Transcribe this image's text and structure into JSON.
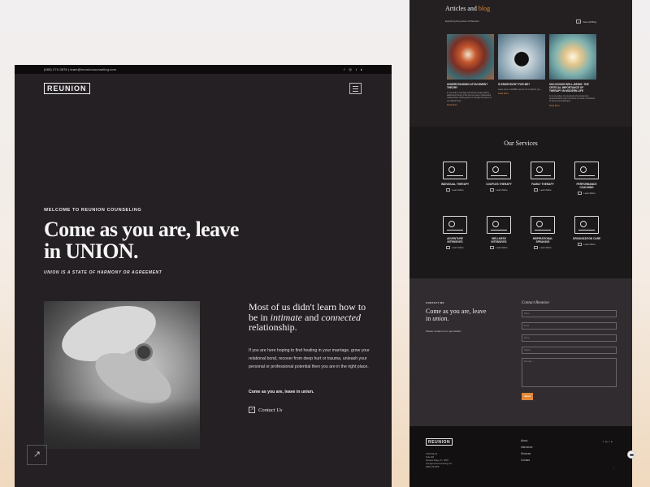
{
  "left": {
    "topbar": {
      "contact": "(585) 270-3878 | team@reunioncounseling.com",
      "socials": [
        "f",
        "◎",
        "t",
        "▸"
      ]
    },
    "logo": "REUNION",
    "welcome": "WELCOME TO REUNION COUNSELING",
    "hero": {
      "title": "Come as you are, leave in UNION.",
      "subtitle": "UNION IS A STATE OF HARMONY OR AGREEMENT"
    },
    "intro": {
      "heading_1": "Most of us didn't learn how to be in ",
      "heading_em1": "intimate",
      "heading_2": " and ",
      "heading_em2": "connected",
      "heading_3": " relationship.",
      "body": "If you are here hoping to find healing in your marriage, grow your relational bond, recover from deep hurt or trauma, unleash your personal or professional potential then you are in the right place.",
      "tagline": "Come as you are, leave in union.",
      "contact_label": "Contact Us"
    },
    "scroll_icon": "↗"
  },
  "right": {
    "blog": {
      "title_1": "Articles and ",
      "title_accent": "blog",
      "subtitle": "Exploring the power of Reunion",
      "view_all": "View all Blog",
      "cards": [
        {
          "title": "UNDERSTANDING ATTACHMENT THEORY",
          "excerpt": "In our work in marriage and family therapy (MFT), attachment theory is the lens we use to understand relationships, helping guide us through the layers of our attachments.",
          "more": "Read More"
        },
        {
          "title": "IS EMDR RIGHT FOR ME?",
          "excerpt": "Learn more on EMDR and see if it is right for you...",
          "more": "Read More"
        },
        {
          "title": "UNLOCKING WELL-BEING: THE CRITICAL IMPORTANCE OF THERAPY IN MODERN LIFE",
          "excerpt": "In an era where the demands of personal and professional life often intertwine to create a whirlwind of stress and challenges...",
          "more": "Read More"
        }
      ]
    },
    "services": {
      "title": "Our Services",
      "items": [
        {
          "name": "INDIVIDUAL THERAPY",
          "more": "Learn More"
        },
        {
          "name": "COUPLES THERAPY",
          "more": "Learn More"
        },
        {
          "name": "FAMILY THERAPY",
          "more": "Learn More"
        },
        {
          "name": "PERFORMANCE COACHING",
          "more": "Learn More"
        },
        {
          "name": "ADVENTURE INTENSIVES",
          "more": "Learn More"
        },
        {
          "name": "WELLNESS INTENSIVES",
          "more": "Learn More"
        },
        {
          "name": "INSPIRATIONAL SPEAKING",
          "more": "Learn More"
        },
        {
          "name": "ORGANIZATION CARE",
          "more": "Learn More"
        }
      ]
    },
    "contact": {
      "kicker": "CONTACT ME",
      "heading_1": "Come as you are, leave in ",
      "heading_em": "union.",
      "note": "Please contact me to get started",
      "form_title": "Contact Reunion",
      "fields": [
        "Name",
        "Email",
        "Phone",
        "Subject",
        "Message"
      ],
      "submit": "Send"
    },
    "footer": {
      "logo": "REUNION",
      "address": [
        "1790 Holly St",
        "Suite 300",
        "Pleasant Ridge, NY 14567",
        "team@reunioncounseling.com",
        "(585) 270-3878"
      ],
      "nav": [
        "About",
        "Intensives",
        "Services",
        "Contact"
      ],
      "socials": [
        "f",
        "◎",
        "t",
        "▸"
      ],
      "to_top": "↑"
    }
  }
}
